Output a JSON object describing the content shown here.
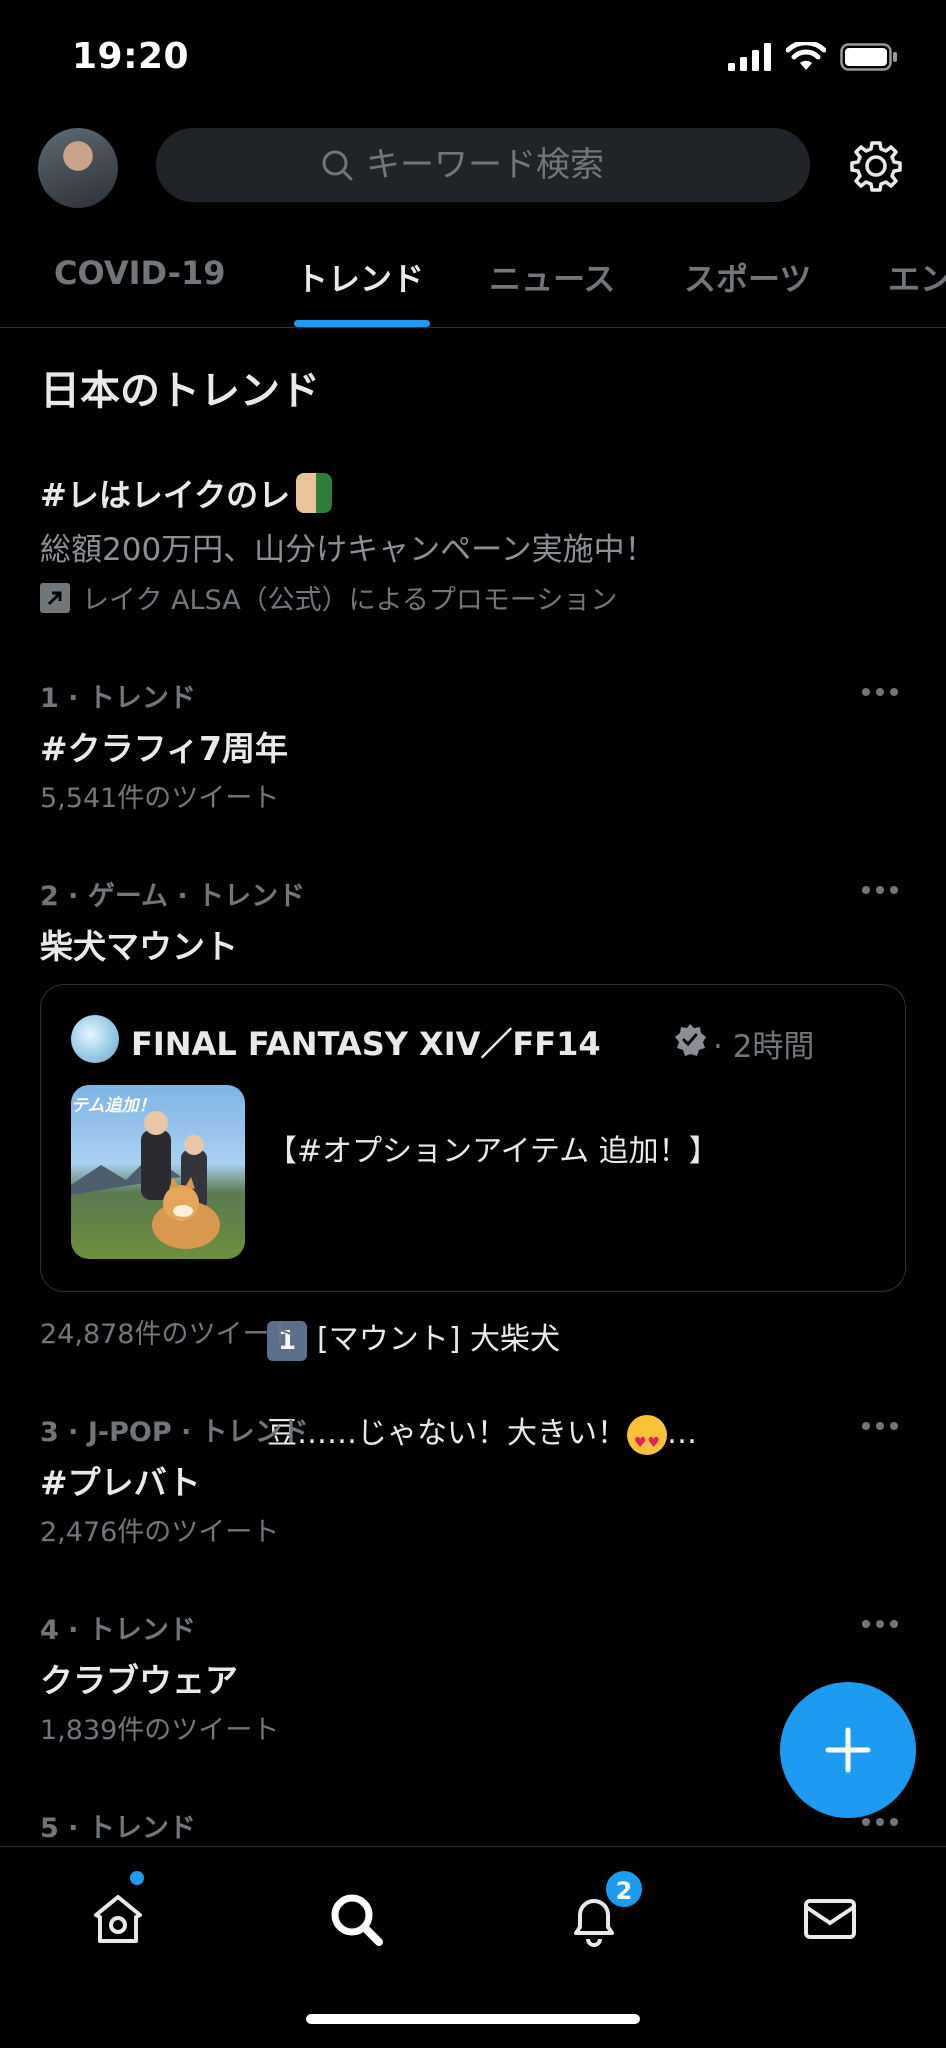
{
  "status_bar": {
    "time": "19:20"
  },
  "header": {
    "search_placeholder": "キーワード検索"
  },
  "tabs": [
    {
      "label": "COVID-19",
      "active": false
    },
    {
      "label": "トレンド",
      "active": true
    },
    {
      "label": "ニュース",
      "active": false
    },
    {
      "label": "スポーツ",
      "active": false
    },
    {
      "label": "エン",
      "active": false
    }
  ],
  "section_title": "日本のトレンド",
  "promoted": {
    "tag": "#レはレイクのレ",
    "description": "総額200万円、山分けキャンペーン実施中！",
    "by": "レイク ALSA（公式）によるプロモーション"
  },
  "trends": [
    {
      "meta": "1 · トレンド",
      "name": "#クラフィ7周年",
      "count": "5,541件のツイート"
    },
    {
      "meta": "2 · ゲーム · トレンド",
      "name": "柴犬マウント",
      "count": "24,878件のツイート"
    },
    {
      "meta": "3 · J-POP · トレンド",
      "name": "#プレバト",
      "count": "2,476件のツイート"
    },
    {
      "meta": "4 · トレンド",
      "name": "クラブウェア",
      "count": "1,839件のツイート"
    },
    {
      "meta": "5 · トレンド",
      "name": "",
      "count": ""
    }
  ],
  "embedded_tweet": {
    "author": "FINAL FANTASY XIV／FF14",
    "time": "· 2時間",
    "thumb_label": "テム追加！",
    "line1": "【#オプションアイテム 追加！】",
    "keycap": "1",
    "line2": "[マウント] 大柴犬",
    "line3": "豆……じゃない！大きい！",
    "ellipsis": "…"
  },
  "nav": {
    "notifications_badge": "2"
  },
  "colors": {
    "accent": "#1d9bf0",
    "background": "#000000",
    "secondary_text": "#71767b"
  }
}
